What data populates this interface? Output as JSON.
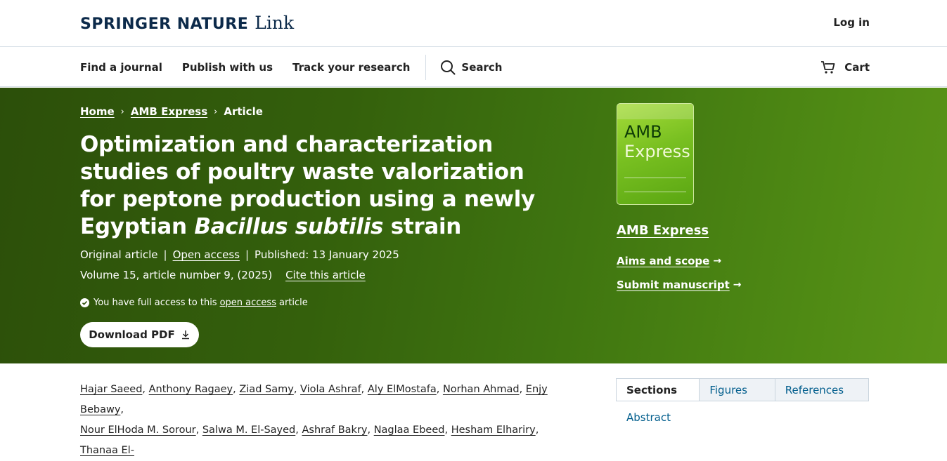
{
  "header": {
    "brand": "SPRINGER NATURE",
    "brand_suffix": "Link",
    "login": "Log in"
  },
  "nav": {
    "items": [
      "Find a journal",
      "Publish with us",
      "Track your research"
    ],
    "search": "Search",
    "cart": "Cart"
  },
  "breadcrumb": {
    "home": "Home",
    "journal": "AMB Express",
    "current": "Article"
  },
  "article": {
    "title_plain": "Optimization and characterization studies of poultry waste valorization for peptone production using a newly Egyptian",
    "title_italic": "Bacillus subtilis",
    "title_end": "strain",
    "type": "Original article",
    "access": "Open access",
    "published": "Published: 13 January 2025",
    "volume": "Volume 15, article number 9, (2025)",
    "cite": "Cite this article",
    "access_note_prefix": "You have full access to this",
    "access_note_link": "open access",
    "access_note_suffix": "article",
    "download": "Download PDF"
  },
  "journal": {
    "cover_line1": "AMB",
    "cover_line2": "Express",
    "name": "AMB Express",
    "aims": "Aims and scope",
    "submit": "Submit manuscript"
  },
  "authors": [
    "Hajar Saeed",
    "Anthony Ragaey",
    "Ziad Samy",
    "Viola Ashraf",
    "Aly ElMostafa",
    "Norhan Ahmad",
    "Enjy Bebawy",
    "Nour ElHoda M. Sorour",
    "Salwa M. El-Sayed",
    "Ashraf Bakry",
    "Naglaa Ebeed",
    "Hesham Elhariry",
    "Thanaa El-"
  ],
  "tabs": [
    "Sections",
    "Figures",
    "References"
  ],
  "sections": {
    "first": "Abstract"
  },
  "colors": {
    "hero_start": "#2c4f0a",
    "hero_end": "#5a9418",
    "link": "#025e8d",
    "brand": "#0c2a4a"
  }
}
